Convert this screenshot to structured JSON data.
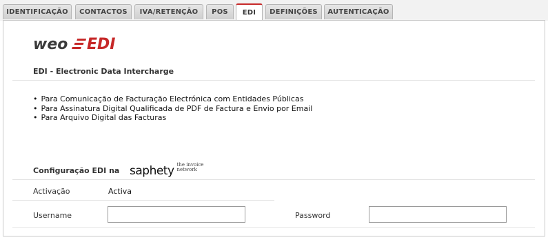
{
  "tabs": [
    {
      "label": "IDENTIFICAÇÃO",
      "active": false
    },
    {
      "label": "CONTACTOS",
      "active": false
    },
    {
      "label": "IVA/RETENÇÃO",
      "active": false
    },
    {
      "label": "POS",
      "active": false
    },
    {
      "label": "EDI",
      "active": true
    },
    {
      "label": "DEFINIÇÕES",
      "active": false
    },
    {
      "label": "AUTENTICAÇÃO",
      "active": false
    }
  ],
  "logo": {
    "part1": "weo",
    "part2": "EDI"
  },
  "edi": {
    "title": "EDI - Electronic Data Intercharge",
    "features": [
      "Para Comunicação de Facturação Electrónica com Entidades Públicas",
      "Para Assinatura Digital Qualificada de PDF de Factura e Envio por Email",
      "Para Arquivo Digital das Facturas"
    ]
  },
  "config": {
    "title": "Configuração EDI na",
    "brand_name": "saphety",
    "brand_tagline_1": "the invoice",
    "brand_tagline_2": "network",
    "activation_label": "Activação",
    "activation_value": "Activa",
    "username_label": "Username",
    "username_value": "",
    "password_label": "Password",
    "password_value": ""
  },
  "colors": {
    "accent": "#c62828",
    "logo_grey": "#3a3a3a"
  }
}
